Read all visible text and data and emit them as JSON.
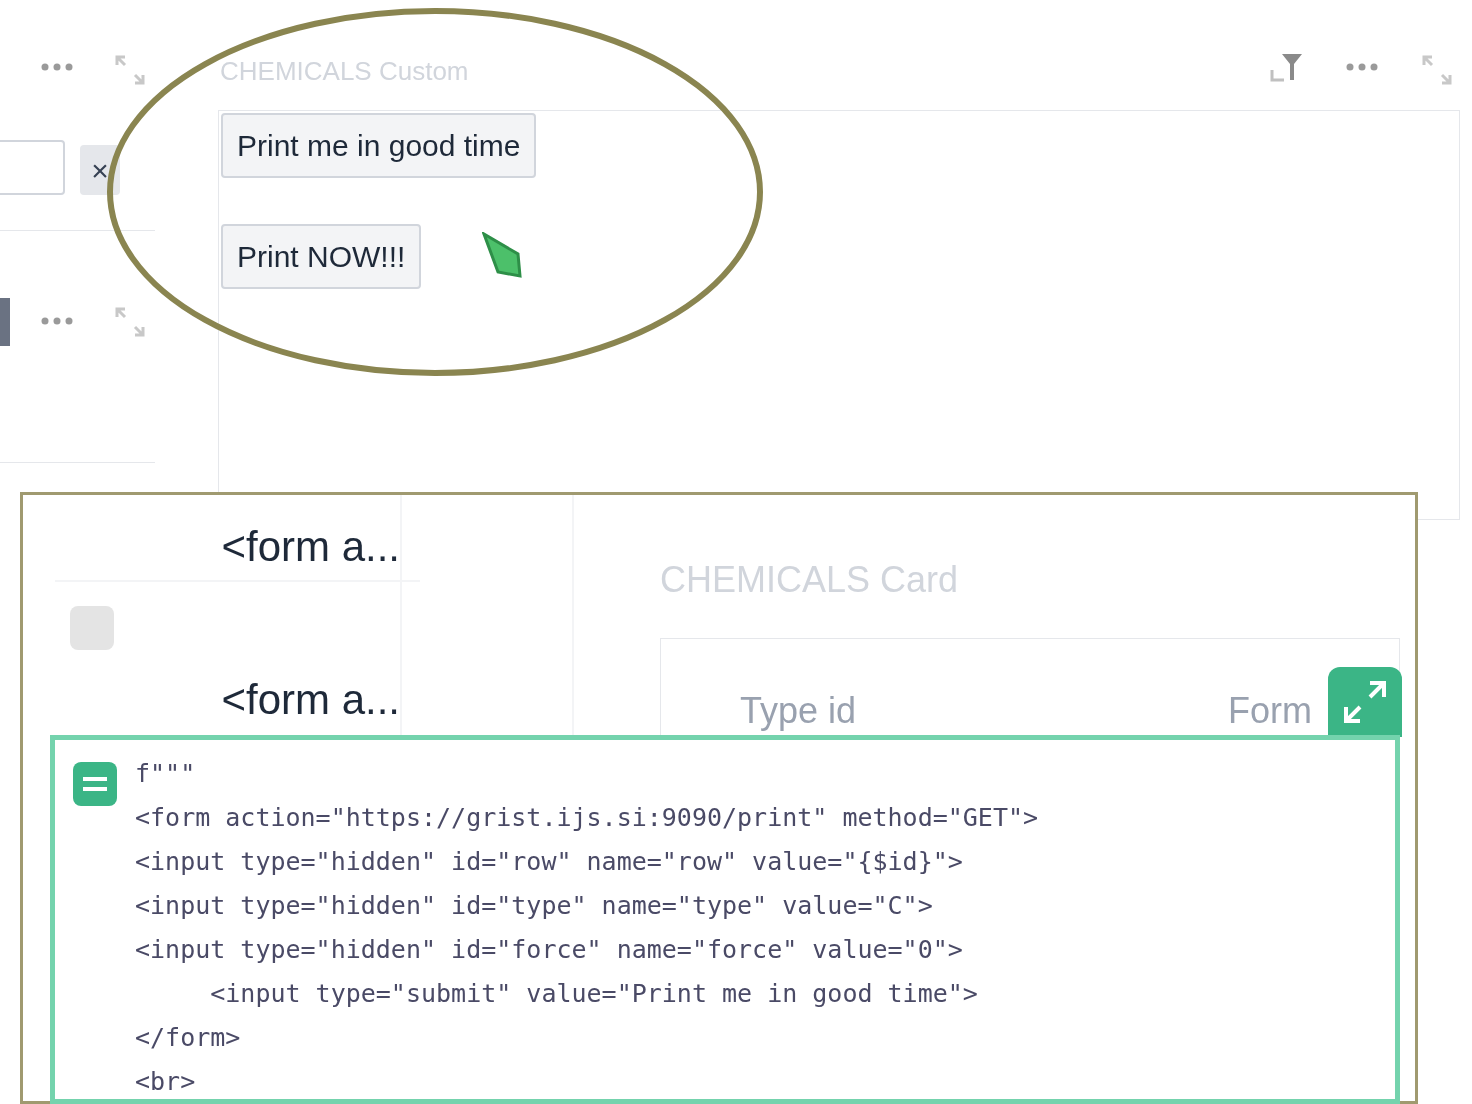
{
  "left_strip": {
    "clear_button": "×"
  },
  "custom_widget": {
    "title": "CHEMICALS Custom",
    "buttons": [
      {
        "label": "Print me in good time"
      },
      {
        "label": "Print NOW!!!"
      }
    ]
  },
  "grid": {
    "cells": [
      "<form a...",
      "<form a..."
    ]
  },
  "card_widget": {
    "title": "CHEMICALS Card",
    "fields": [
      "Type id",
      "Form"
    ]
  },
  "formula_editor": {
    "lines": [
      "f\"\"\"",
      "<form action=\"https://grist.ijs.si:9090/print\" method=\"GET\">",
      "<input type=\"hidden\" id=\"row\" name=\"row\" value=\"{$id}\">",
      "<input type=\"hidden\" id=\"type\" name=\"type\" value=\"C\">",
      "<input type=\"hidden\" id=\"force\" name=\"force\" value=\"0\">",
      "     <input type=\"submit\" value=\"Print me in good time\">",
      "</form>",
      "<br>"
    ]
  }
}
